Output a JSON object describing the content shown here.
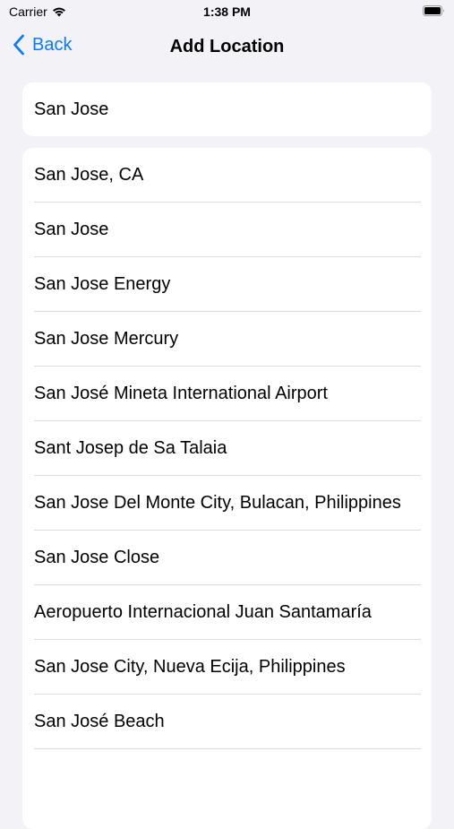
{
  "status_bar": {
    "carrier": "Carrier",
    "time": "1:38 PM",
    "wifi_icon": "wifi-icon",
    "battery_icon": "battery-icon"
  },
  "nav": {
    "back_label": "Back",
    "title": "Add Location",
    "back_icon": "chevron-left-icon",
    "accent_color": "#0a7aff"
  },
  "search": {
    "value": "San Jose"
  },
  "results": [
    "San Jose, CA",
    "San Jose",
    "San Jose Energy",
    "San Jose Mercury",
    "San José Mineta International Airport",
    "Sant Josep de Sa Talaia",
    "San Jose Del Monte City, Bulacan, Philippines",
    "San Jose Close",
    "Aeropuerto Internacional Juan Santamaría",
    "San Jose City, Nueva Ecija, Philippines",
    "San José Beach"
  ],
  "colors": {
    "background": "#f2f2f7",
    "card": "#ffffff",
    "separator": "#dcdce0"
  }
}
